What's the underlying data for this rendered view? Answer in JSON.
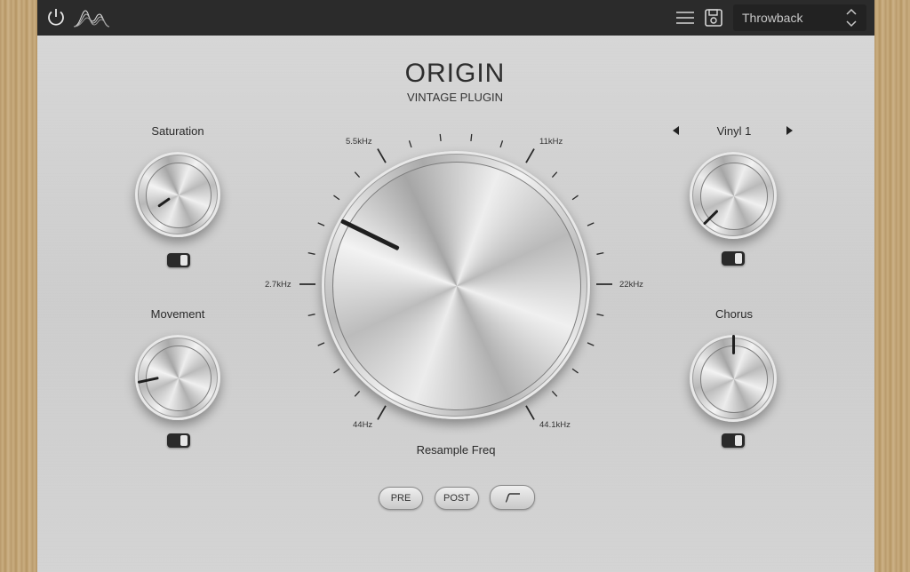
{
  "header": {
    "preset_name": "Throwback",
    "icons": [
      "power-icon",
      "waveform-logo-icon",
      "menu-icon",
      "save-icon"
    ]
  },
  "title": "ORIGIN",
  "subtitle": "VINTAGE PLUGIN",
  "controls": {
    "saturation": {
      "label": "Saturation"
    },
    "movement": {
      "label": "Movement"
    },
    "vinyl": {
      "label": "Vinyl 1"
    },
    "chorus": {
      "label": "Chorus"
    },
    "resample": {
      "label": "Resample Freq",
      "scale": [
        "44Hz",
        "2.7kHz",
        "5.5kHz",
        "11kHz",
        "22kHz",
        "44.1kHz"
      ]
    }
  },
  "buttons": {
    "pre": "PRE",
    "post": "POST"
  },
  "colors": {
    "topbar": "#2b2b2b",
    "panel": "#d4d4d4",
    "pointer": "#1f1f1f"
  }
}
